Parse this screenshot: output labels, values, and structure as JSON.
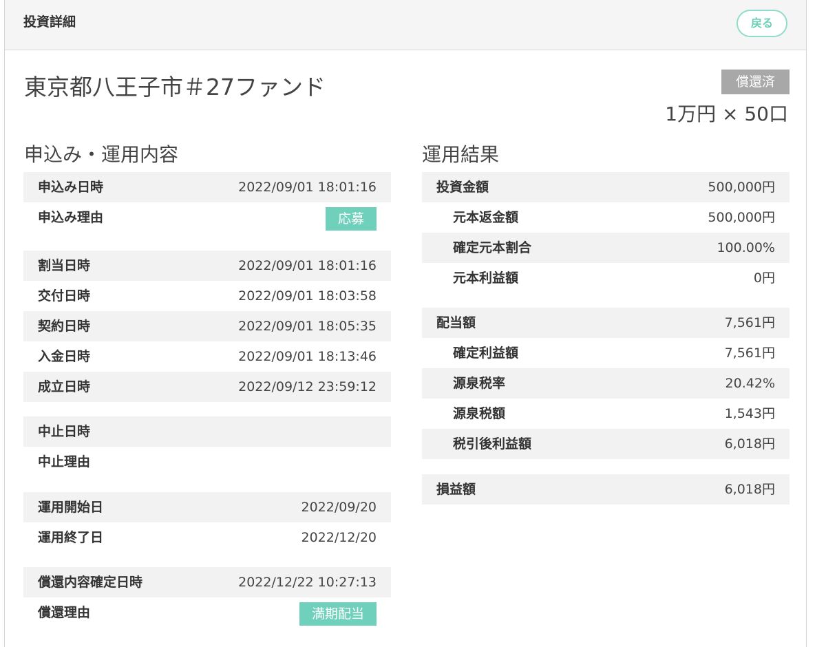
{
  "header": {
    "title": "投資詳細",
    "back_label": "戻る"
  },
  "fund": {
    "title": "東京都八王子市＃27ファンド",
    "status": "償還済",
    "units": "1万円 × 50口"
  },
  "application": {
    "section_title": "申込み・運用内容",
    "rows": [
      {
        "label": "申込み日時",
        "value": "2022/09/01 18:01:16"
      },
      {
        "label": "申込み理由",
        "tag": "応募"
      },
      {
        "label": "割当日時",
        "value": "2022/09/01 18:01:16"
      },
      {
        "label": "交付日時",
        "value": "2022/09/01 18:03:58"
      },
      {
        "label": "契約日時",
        "value": "2022/09/01 18:05:35"
      },
      {
        "label": "入金日時",
        "value": "2022/09/01 18:13:46"
      },
      {
        "label": "成立日時",
        "value": "2022/09/12 23:59:12"
      },
      {
        "label": "中止日時",
        "value": ""
      },
      {
        "label": "中止理由",
        "value": ""
      },
      {
        "label": "運用開始日",
        "value": "2022/09/20"
      },
      {
        "label": "運用終了日",
        "value": "2022/12/20"
      },
      {
        "label": "償還内容確定日時",
        "value": "2022/12/22 10:27:13"
      },
      {
        "label": "償還理由",
        "tag": "満期配当"
      }
    ]
  },
  "results": {
    "section_title": "運用結果",
    "rows": [
      {
        "label": "投資金額",
        "value": "500,000円"
      },
      {
        "label": "元本返金額",
        "value": "500,000円"
      },
      {
        "label": "確定元本割合",
        "value": "100.00%"
      },
      {
        "label": "元本利益額",
        "value": "0円"
      },
      {
        "label": "配当額",
        "value": "7,561円"
      },
      {
        "label": "確定利益額",
        "value": "7,561円"
      },
      {
        "label": "源泉税率",
        "value": "20.42%"
      },
      {
        "label": "源泉税額",
        "value": "1,543円"
      },
      {
        "label": "税引後利益額",
        "value": "6,018円"
      },
      {
        "label": "損益額",
        "value": "6,018円"
      }
    ]
  }
}
